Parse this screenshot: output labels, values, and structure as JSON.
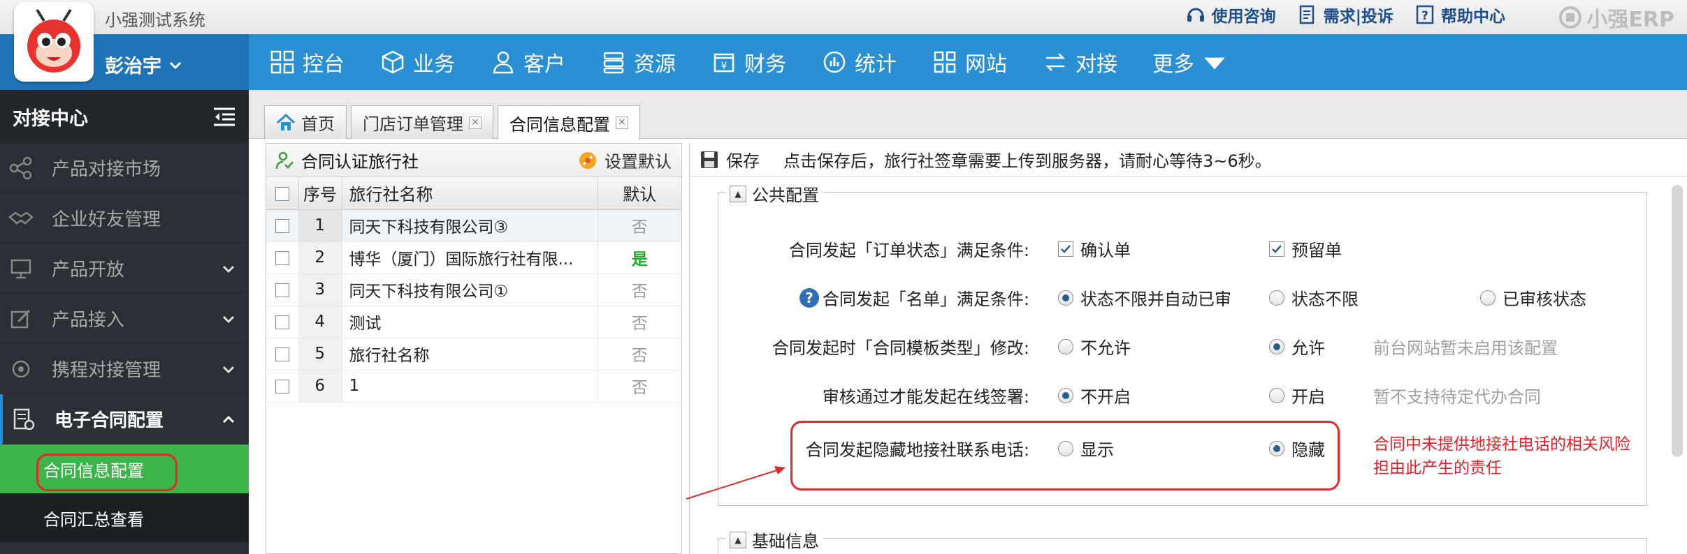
{
  "header": {
    "system_title": "小强测试系统",
    "links": [
      {
        "label": "使用咨询",
        "icon": "headset-icon"
      },
      {
        "label": "需求|投诉",
        "icon": "document-icon"
      },
      {
        "label": "帮助中心",
        "icon": "question-icon"
      }
    ],
    "brand": "小强ERP"
  },
  "user": {
    "name": "彭治宇"
  },
  "nav": [
    {
      "label": "控台",
      "icon": "dashboard-icon"
    },
    {
      "label": "业务",
      "icon": "cube-icon"
    },
    {
      "label": "客户",
      "icon": "user-icon"
    },
    {
      "label": "资源",
      "icon": "database-icon"
    },
    {
      "label": "财务",
      "icon": "finance-icon"
    },
    {
      "label": "统计",
      "icon": "chart-icon"
    },
    {
      "label": "网站",
      "icon": "grid-icon"
    },
    {
      "label": "对接",
      "icon": "exchange-icon"
    },
    {
      "label": "更多"
    }
  ],
  "sidebar": {
    "title": "对接中心",
    "items": [
      {
        "label": "产品对接市场",
        "icon": "share-icon"
      },
      {
        "label": "企业好友管理",
        "icon": "handshake-icon"
      },
      {
        "label": "产品开放",
        "icon": "monitor-icon"
      },
      {
        "label": "产品接入",
        "icon": "edit-icon"
      },
      {
        "label": "携程对接管理",
        "icon": "link-icon"
      },
      {
        "label": "电子合同配置",
        "icon": "contract-icon"
      }
    ],
    "subitems": [
      {
        "label": "合同信息配置"
      },
      {
        "label": "合同汇总查看"
      }
    ]
  },
  "tabs": [
    {
      "label": "首页"
    },
    {
      "label": "门店订单管理"
    },
    {
      "label": "合同信息配置"
    }
  ],
  "agency_panel": {
    "title": "合同认证旅行社",
    "set_default": "设置默认",
    "columns": [
      "序号",
      "旅行社名称",
      "默认"
    ],
    "rows": [
      {
        "idx": "1",
        "name": "同天下科技有限公司③",
        "default": "否"
      },
      {
        "idx": "2",
        "name": "博华（厦门）国际旅行社有限...",
        "default": "是"
      },
      {
        "idx": "3",
        "name": "同天下科技有限公司①",
        "default": "否"
      },
      {
        "idx": "4",
        "name": "测试",
        "default": "否"
      },
      {
        "idx": "5",
        "name": "旅行社名称",
        "default": "否"
      },
      {
        "idx": "6",
        "name": "1",
        "default": "否"
      }
    ]
  },
  "toolbar": {
    "save": "保存",
    "tip": "点击保存后，旅行社签章需要上传到服务器，请耐心等待3~6秒。"
  },
  "public_config": {
    "legend": "公共配置",
    "rows": [
      {
        "label": "合同发起「订单状态」满足条件:",
        "options": [
          "确认单",
          "预留单"
        ]
      },
      {
        "label": "合同发起「名单」满足条件:",
        "options": [
          "状态不限并自动已审",
          "状态不限",
          "已审核状态"
        ]
      },
      {
        "label": "合同发起时「合同模板类型」修改:",
        "options": [
          "不允许",
          "允许"
        ],
        "hint": "前台网站暂未启用该配置"
      },
      {
        "label": "审核通过才能发起在线签署:",
        "options": [
          "不开启",
          "开启"
        ],
        "hint": "暂不支持待定代办合同"
      },
      {
        "label": "合同发起隐藏地接社联系电话:",
        "options": [
          "显示",
          "隐藏"
        ],
        "warning_line1": "合同中未提供地接社电话的相关风险",
        "warning_line2": "担由此产生的责任"
      }
    ]
  },
  "basic_info": {
    "legend": "基础信息"
  }
}
